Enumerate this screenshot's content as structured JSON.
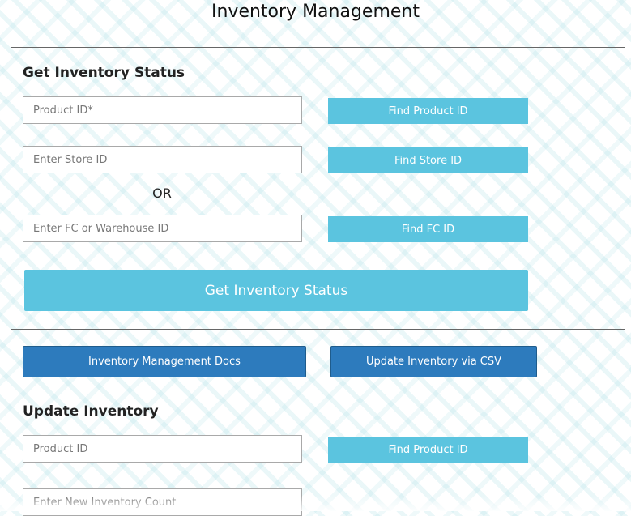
{
  "page": {
    "title": "Inventory Management"
  },
  "get_status": {
    "heading": "Get Inventory Status",
    "product_id_placeholder": "Product ID*",
    "find_product_label": "Find Product ID",
    "store_id_placeholder": "Enter Store ID",
    "find_store_label": "Find Store ID",
    "or_label": "OR",
    "fc_id_placeholder": "Enter FC or Warehouse ID",
    "find_fc_label": "Find FC ID",
    "submit_label": "Get Inventory Status"
  },
  "actions": {
    "docs_label": "Inventory Management Docs",
    "csv_label": "Update Inventory via CSV"
  },
  "update": {
    "heading": "Update Inventory",
    "product_id_placeholder": "Product ID",
    "find_product_label": "Find Product ID",
    "new_count_placeholder": "Enter New Inventory Count"
  },
  "colors": {
    "teal_button": "#5bc4df",
    "dark_button": "#2d7bbd",
    "pattern": "#7dcdd7"
  }
}
